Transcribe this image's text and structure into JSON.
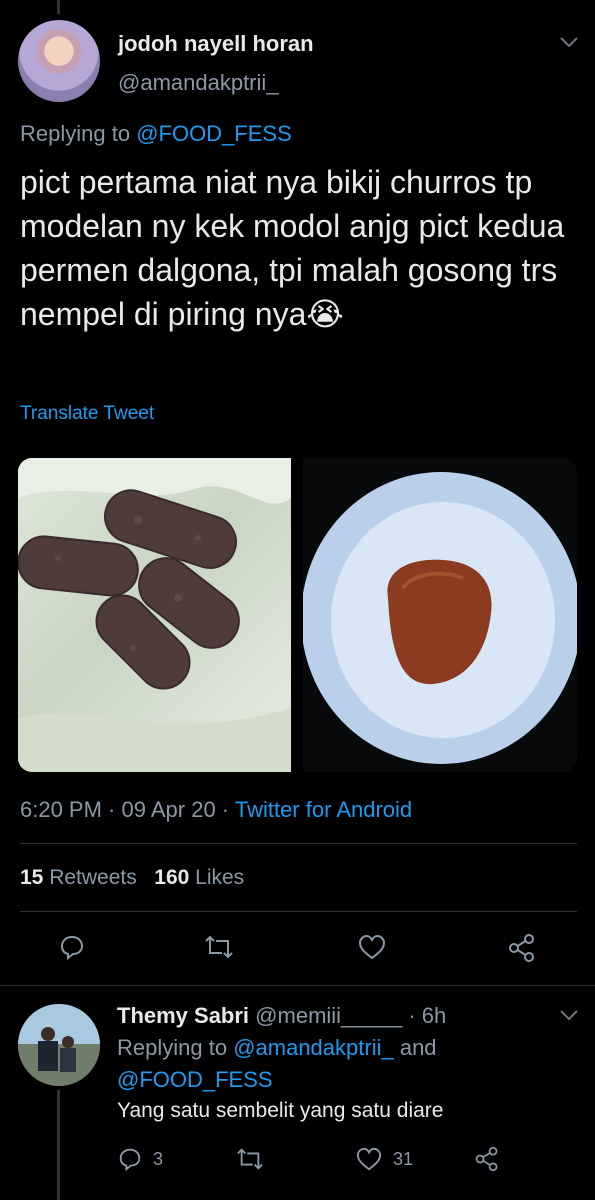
{
  "tweet": {
    "author_name": "jodoh nayell horan",
    "author_handle": "@amandakptrii_",
    "replying_label": "Replying to ",
    "replying_to": "@FOOD_FESS",
    "text": "pict pertama niat nya bikij churros tp modelan ny kek modol anjg pict kedua permen dalgona, tpi malah gosong trs nempel di piring nya😭",
    "translate_label": "Translate Tweet",
    "time": "6:20 PM",
    "date": "09 Apr 20",
    "source": "Twitter for Android",
    "retweet_count": "15",
    "retweet_label": "Retweets",
    "like_count": "160",
    "like_label": "Likes"
  },
  "reply": {
    "author_name": "Themy Sabri",
    "author_handle": "@memiii_____",
    "age": "6h",
    "replying_label": "Replying to ",
    "replying_to_1": "@amandakptrii_",
    "and_label": " and",
    "replying_to_2": "@FOOD_FESS",
    "text": "Yang satu sembelit yang satu diare",
    "reply_count": "3",
    "like_count": "31"
  },
  "colors": {
    "background": "#000000",
    "link": "#1d9bf0",
    "muted": "#8b98a5",
    "text": "#e7e9ea"
  },
  "icons": [
    "chevron-down-icon",
    "reply-icon",
    "retweet-icon",
    "like-icon",
    "share-icon"
  ]
}
